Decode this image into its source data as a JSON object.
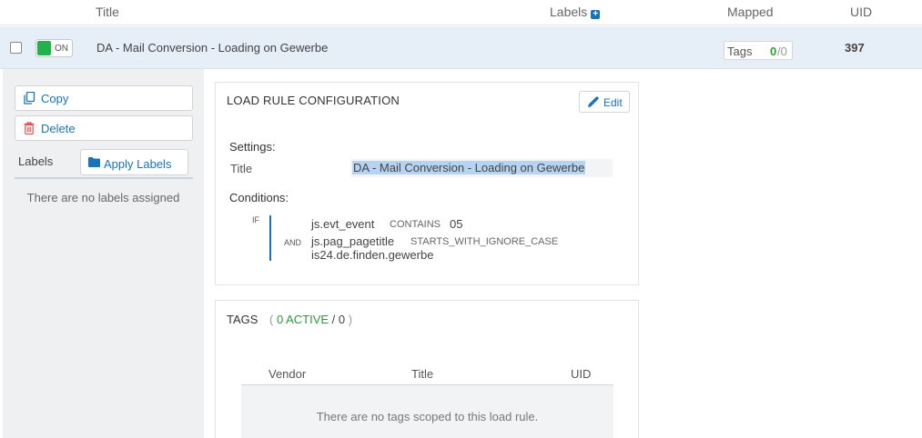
{
  "header": {
    "title_col": "Title",
    "labels_col": "Labels",
    "labels_add_icon": "plus-square-icon",
    "mapped_col": "Mapped",
    "uid_col": "UID"
  },
  "row": {
    "toggle_label": "ON",
    "toggle_color": "#22b24c",
    "title": "DA - Mail Conversion - Loading on Gewerbe",
    "tags_label": "Tags",
    "tags_active": "0",
    "tags_separator": "/",
    "tags_total": "0",
    "uid": "397"
  },
  "sidebar": {
    "copy_label": "Copy",
    "delete_label": "Delete",
    "labels_heading": "Labels",
    "apply_labels_label": "Apply Labels",
    "no_labels_text": "There are no labels assigned"
  },
  "config": {
    "heading": "LOAD RULE CONFIGURATION",
    "edit_label": "Edit",
    "settings_heading": "Settings:",
    "title_label": "Title",
    "title_value": "DA - Mail Conversion - Loading on Gewerbe",
    "conditions_heading": "Conditions:",
    "if_label": "IF",
    "and_label": "AND",
    "condition1": {
      "variable": "js.evt_event",
      "operator": "CONTAINS",
      "value": "05"
    },
    "condition2": {
      "variable": "js.pag_pagetitle",
      "operator": "STARTS_WITH_IGNORE_CASE",
      "value": "is24.de.finden.gewerbe"
    }
  },
  "tags": {
    "heading": "TAGS",
    "open_paren": "(",
    "active_text": "0 ACTIVE",
    "slash": "/",
    "total": "0",
    "close_paren": ")",
    "columns": [
      "Vendor",
      "Title",
      "UID"
    ],
    "empty_text": "There are no tags scoped to this load rule."
  },
  "colors": {
    "accent": "#1a73b8",
    "active_green": "#2b9a39",
    "selected_row_bg": "#e6eef7",
    "delete_red": "#d9534f"
  }
}
